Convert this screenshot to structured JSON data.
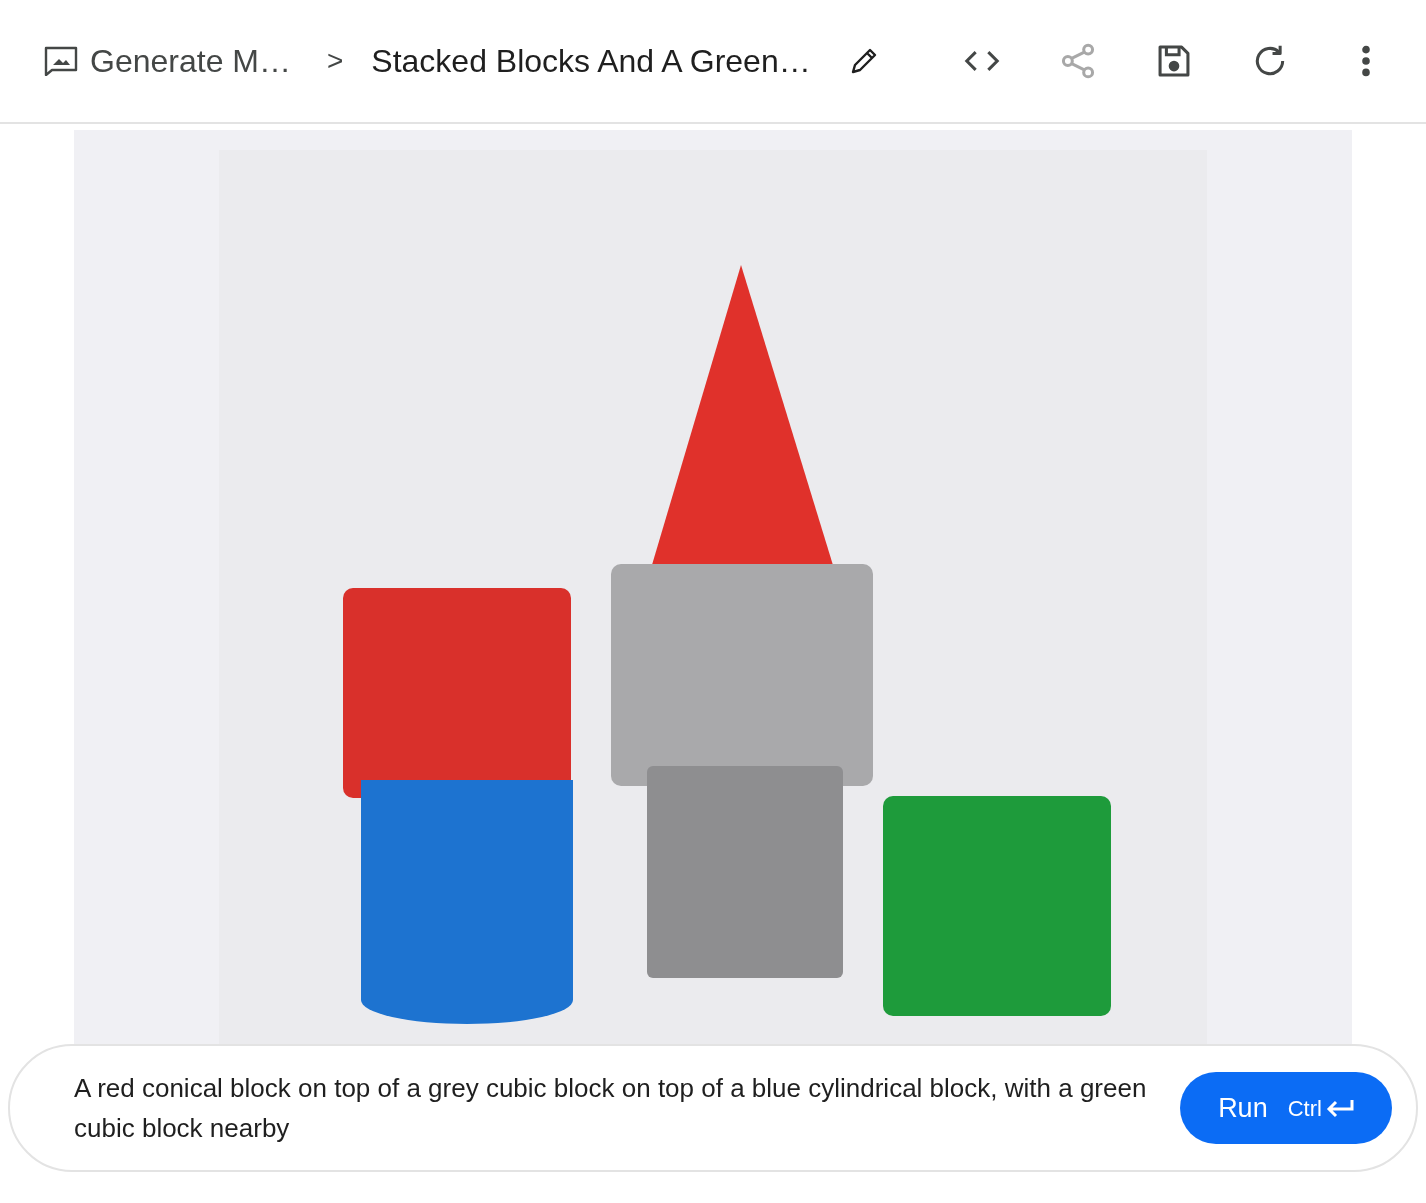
{
  "breadcrumb": {
    "parent": "Generate M…",
    "separator": ">",
    "title": "Stacked Blocks And A Green…"
  },
  "toolbar": [
    {
      "kind": "code",
      "disabled": false
    },
    {
      "kind": "share",
      "disabled": true
    },
    {
      "kind": "save",
      "disabled": false
    },
    {
      "kind": "refresh",
      "disabled": false
    },
    {
      "kind": "more",
      "disabled": false
    }
  ],
  "prompt": {
    "value": "A red conical block on top of a grey cubic block on top of a blue cylindrical block, with a green cubic block nearby"
  },
  "run_button": {
    "label": "Run",
    "shortcut": "Ctrl"
  }
}
